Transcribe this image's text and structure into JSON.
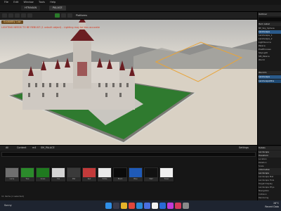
{
  "menubar": {
    "items": [
      "File",
      "Edit",
      "Window",
      "Tools",
      "Help"
    ]
  },
  "tabs": [
    {
      "label": "HTRAKAN",
      "active": false
    },
    {
      "label": "PALACE",
      "active": true
    }
  ],
  "toolbar": {
    "platform_label": "Platforms"
  },
  "viewport": {
    "badge": "Scalability: Low",
    "warning": "LIGHTING NEEDS TO BE REBUILT (1 unbuilt object) - Lighting may be less accurate"
  },
  "outliner": {
    "title": "Outliner",
    "rows": [
      "Item Label",
      "BP_Sky_Sphere",
      "Landscape",
      "Landscape_1",
      "Landscape_2",
      "LightSource",
      "Palace",
      "PostProcess",
      "SkyLight",
      "SM_Palace",
      "World"
    ],
    "world_label": "World S",
    "selected": [
      "Landscape",
      "LandscapeStre"
    ]
  },
  "content_browser": {
    "path": [
      "All",
      "Content",
      "m4",
      "SM_PALACE"
    ],
    "settings_label": "Settings",
    "assets": [
      {
        "name": "Lamp",
        "color": "#6f6f6f"
      },
      {
        "name": "Tree",
        "color": "#2b8a2b"
      },
      {
        "name": "Grass",
        "color": "#1f7a1f"
      },
      {
        "name": "Tile",
        "color": "#d4d4d4"
      },
      {
        "name": "Mat",
        "color": "#3a3a3a"
      },
      {
        "name": "Red",
        "color": "#c23a3a"
      },
      {
        "name": "White",
        "color": "#e8e8e8"
      },
      {
        "name": "Black",
        "color": "#0a0a0a"
      },
      {
        "name": "Blue",
        "color": "#1f5ab8"
      },
      {
        "name": "Wall",
        "color": "#111111"
      },
      {
        "name": "Tower",
        "color": "#f0f0f0"
      }
    ],
    "status": "11 items (1 selected)"
  },
  "details": {
    "title": "Details",
    "rows": [
      {
        "label": "Landscape",
        "section": true
      },
      {
        "label": "Transform",
        "section": true
      },
      {
        "label": "Location"
      },
      {
        "label": "Rotation"
      },
      {
        "label": "Scale"
      },
      {
        "label": "Information",
        "section": true
      },
      {
        "label": "Landscape",
        "section": true
      },
      {
        "label": "Landscape Mat"
      },
      {
        "label": "Landscape Hole"
      },
      {
        "label": "Target Display"
      },
      {
        "label": "Landscape Phys"
      },
      {
        "label": "Navigation"
      },
      {
        "label": "Collision"
      },
      {
        "label": "Rendering"
      }
    ]
  },
  "taskbar": {
    "weather": "Sunny",
    "time": "28°C",
    "date": "Recent Data",
    "icons": [
      {
        "name": "windows",
        "color": "#2f8fe8"
      },
      {
        "name": "search",
        "color": "#3a3a4a"
      },
      {
        "name": "explorer",
        "color": "#e6b32a"
      },
      {
        "name": "chrome",
        "color": "#e0463a"
      },
      {
        "name": "edge",
        "color": "#2a8ad6"
      },
      {
        "name": "store",
        "color": "#4a6fe0"
      },
      {
        "name": "unreal",
        "color": "#f2f2f2"
      },
      {
        "name": "mail",
        "color": "#2a6ad6"
      },
      {
        "name": "photos",
        "color": "#c23ad6"
      },
      {
        "name": "app",
        "color": "#d63a5a"
      },
      {
        "name": "app2",
        "color": "#8a8a8a"
      }
    ]
  }
}
